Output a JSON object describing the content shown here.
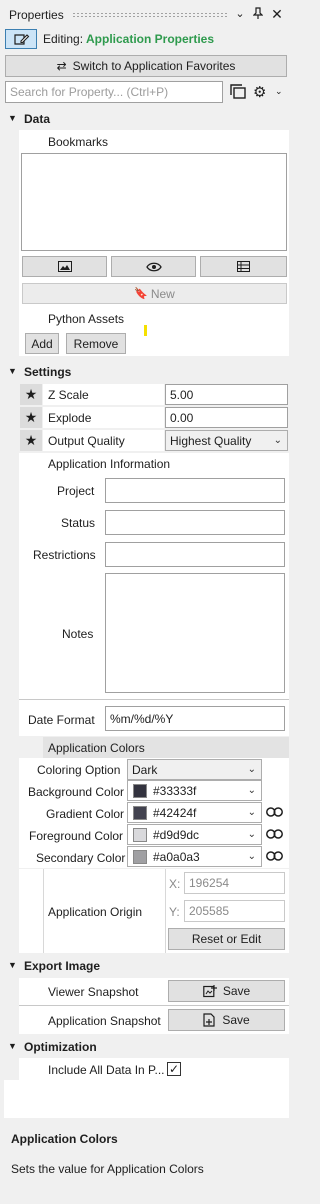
{
  "window": {
    "title": "Properties",
    "icons": [
      "chevron-down-icon",
      "pin-icon",
      "close-icon"
    ]
  },
  "editing": {
    "label": "Editing:",
    "value": "Application Properties",
    "value_color": "#2e9a4d"
  },
  "switch_button": {
    "label": "Switch to Application Favorites"
  },
  "search": {
    "placeholder": "Search for Property... (Ctrl+P)"
  },
  "sections": {
    "data": "Data",
    "settings": "Settings",
    "export_image": "Export Image",
    "optimization": "Optimization"
  },
  "data": {
    "bookmarks_label": "Bookmarks",
    "new_button": "New",
    "python_assets_label": "Python Assets",
    "add_button": "Add",
    "remove_button": "Remove"
  },
  "settings": {
    "z_scale": {
      "label": "Z Scale",
      "value": "5.00"
    },
    "explode": {
      "label": "Explode",
      "value": "0.00"
    },
    "output_quality": {
      "label": "Output Quality",
      "value": "Highest Quality"
    },
    "app_info_header": "Application Information",
    "project_label": "Project",
    "status_label": "Status",
    "restrictions_label": "Restrictions",
    "notes_label": "Notes",
    "date_format": {
      "label": "Date Format",
      "value": "%m/%d/%Y"
    },
    "app_colors_header": "Application Colors",
    "coloring_option": {
      "label": "Coloring Option",
      "value": "Dark"
    },
    "colors": [
      {
        "label": "Background Color",
        "value": "#33333f",
        "swatch": "#33333f",
        "linked": false
      },
      {
        "label": "Gradient Color",
        "value": "#42424f",
        "swatch": "#42424f",
        "linked": true
      },
      {
        "label": "Foreground Color",
        "value": "#d9d9dc",
        "swatch": "#d9d9dc",
        "linked": true
      },
      {
        "label": "Secondary Color",
        "value": "#a0a0a3",
        "swatch": "#a0a0a3",
        "linked": true
      }
    ],
    "origin": {
      "label": "Application Origin",
      "x_label": "X:",
      "x_value": "196254",
      "y_label": "Y:",
      "y_value": "205585",
      "reset_button": "Reset or Edit"
    }
  },
  "export_image": {
    "viewer_label": "Viewer Snapshot",
    "viewer_button": "Save",
    "app_label": "Application Snapshot",
    "app_button": "Save"
  },
  "optimization": {
    "include_label": "Include All Data In P...",
    "include_checked": true
  },
  "description": {
    "title": "Application Colors",
    "text": "Sets the value for Application Colors"
  }
}
